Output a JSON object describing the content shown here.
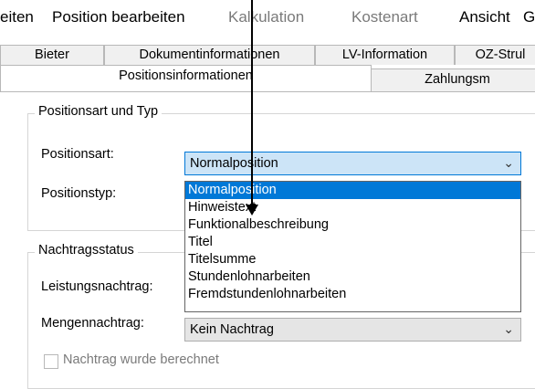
{
  "menubar": {
    "items": [
      {
        "label": "eiten",
        "enabled": true
      },
      {
        "label": "Position bearbeiten",
        "enabled": true
      },
      {
        "label": "Kalkulation",
        "enabled": false
      },
      {
        "label": "Kostenart",
        "enabled": false
      },
      {
        "label": "Ansicht",
        "enabled": true
      },
      {
        "label": "G",
        "enabled": true
      }
    ]
  },
  "tabs": {
    "row1": [
      "Bieter",
      "Dokumentinformationen",
      "LV-Information",
      "OZ-Strul"
    ],
    "row2": [
      "Positionsinformationen",
      "Zahlungsm"
    ]
  },
  "group_type": {
    "title": "Positionsart und Typ",
    "positionsart_label": "Positionsart:",
    "positionsart_value": "Normalposition",
    "positionstyp_label": "Positionstyp:"
  },
  "dropdown": {
    "options": [
      "Normalposition",
      "Hinweistext",
      "Funktionalbeschreibung",
      "Titel",
      "Titelsumme",
      "Stundenlohnarbeiten",
      "Fremdstundenlohnarbeiten"
    ],
    "selected_index": 0
  },
  "group_nachtrag": {
    "title": "Nachtragsstatus",
    "leistung_label": "Leistungsnachtrag:",
    "mengen_label": "Mengennachtrag:",
    "mengen_value": "Kein Nachtrag",
    "checkbox_label": "Nachtrag wurde berechnet"
  },
  "icons": {
    "chevron": "chevron-down-icon"
  }
}
